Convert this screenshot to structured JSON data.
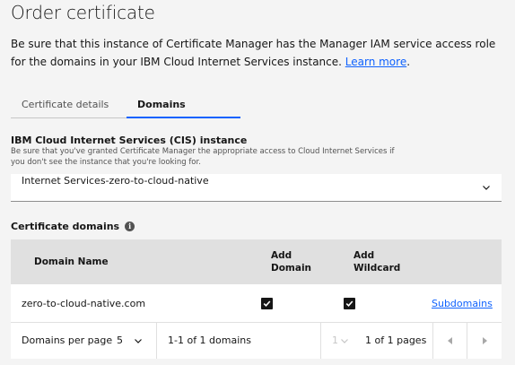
{
  "page": {
    "title": "Order certificate",
    "intro_text": "Be sure that this instance of Certificate Manager has the Manager IAM service access role for the domains in your IBM Cloud Internet Services instance. ",
    "intro_link": "Learn more",
    "intro_end": "."
  },
  "tabs": [
    {
      "label": "Certificate details",
      "active": false
    },
    {
      "label": "Domains",
      "active": true
    }
  ],
  "cis": {
    "label": "IBM Cloud Internet Services (CIS) instance",
    "help": "Be sure that you've granted Certificate Manager the appropriate access to Cloud Internet Services if you don't see the instance that you're looking for.",
    "selected": "Internet Services-zero-to-cloud-native",
    "chevron_icon": "chevron-down-icon"
  },
  "domains": {
    "label": "Certificate domains",
    "info_icon": "info-icon",
    "columns": {
      "name": "Domain Name",
      "add_domain_1": "Add",
      "add_domain_2": "Domain",
      "add_wildcard_1": "Add",
      "add_wildcard_2": "Wildcard"
    },
    "rows": [
      {
        "name": "zero-to-cloud-native.com",
        "add_domain": true,
        "add_wildcard": true,
        "link": "Subdomains"
      }
    ]
  },
  "pagination": {
    "per_page_label": "Domains per page",
    "per_page_value": "5",
    "range_text": "1-1 of 1 domains",
    "page_value": "1",
    "pages_text": "1 of 1 pages",
    "prev_icon": "caret-left-icon",
    "next_icon": "caret-right-icon"
  },
  "colors": {
    "accent": "#0f62fe",
    "background": "#f4f4f4",
    "header_bg": "#e0e0e0"
  }
}
